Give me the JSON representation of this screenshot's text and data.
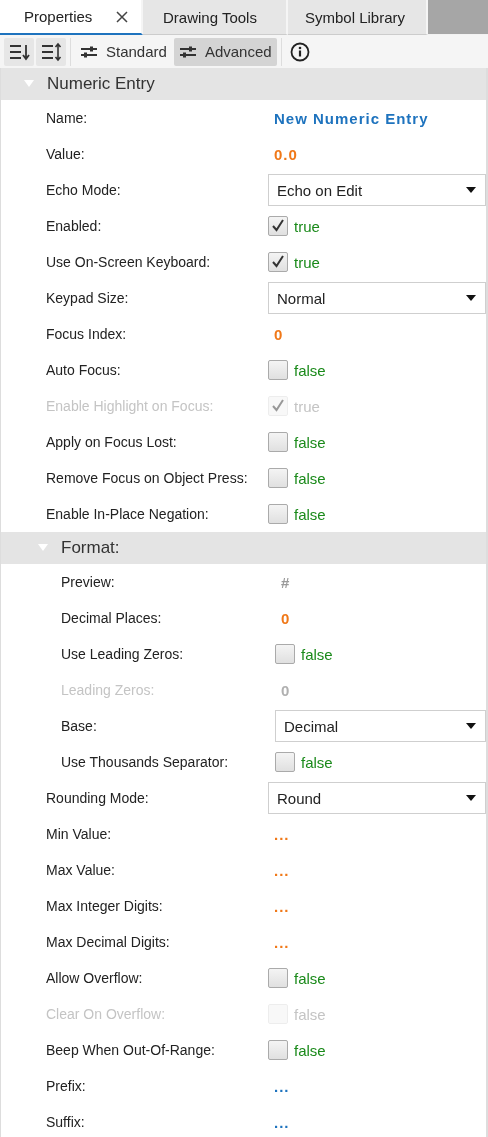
{
  "tabs": [
    {
      "label": "Properties",
      "selected": true,
      "closable": true
    },
    {
      "label": "Drawing Tools",
      "selected": false,
      "closable": false
    },
    {
      "label": "Symbol Library",
      "selected": false,
      "closable": false
    }
  ],
  "toolbar": {
    "views": [
      {
        "label": "Standard",
        "selected": false
      },
      {
        "label": "Advanced",
        "selected": true
      }
    ]
  },
  "section": {
    "title": "Numeric Entry",
    "expanded": true,
    "rows": [
      {
        "kind": "text",
        "label": "Name:",
        "value": "New Numeric Entry",
        "color": "#1e73be",
        "disabled": false
      },
      {
        "kind": "text",
        "label": "Value:",
        "value": "0.0",
        "color": "#f07818",
        "disabled": false
      },
      {
        "kind": "dropdown",
        "label": "Echo Mode:",
        "value": "Echo on Edit",
        "disabled": false
      },
      {
        "kind": "checkbox",
        "label": "Enabled:",
        "checked": true,
        "value": "true",
        "disabled": false
      },
      {
        "kind": "checkbox",
        "label": "Use On-Screen Keyboard:",
        "checked": true,
        "value": "true",
        "disabled": false
      },
      {
        "kind": "dropdown",
        "label": "Keypad Size:",
        "value": "Normal",
        "disabled": false
      },
      {
        "kind": "text",
        "label": "Focus Index:",
        "value": "0",
        "color": "#f07818",
        "disabled": false
      },
      {
        "kind": "checkbox",
        "label": "Auto Focus:",
        "checked": false,
        "value": "false",
        "disabled": false
      },
      {
        "kind": "checkbox",
        "label": "Enable Highlight on Focus:",
        "checked": true,
        "value": "true",
        "disabled": true
      },
      {
        "kind": "checkbox",
        "label": "Apply on Focus Lost:",
        "checked": false,
        "value": "false",
        "disabled": false
      },
      {
        "kind": "checkbox",
        "label": "Remove Focus on Object Press:",
        "checked": false,
        "value": "false",
        "disabled": false
      },
      {
        "kind": "checkbox",
        "label": "Enable In-Place Negation:",
        "checked": false,
        "value": "false",
        "disabled": false
      },
      {
        "kind": "group",
        "label": "Format:",
        "expanded": true,
        "children": [
          {
            "kind": "text",
            "label": "Preview:",
            "value": "#",
            "color": "#9a9a9a",
            "disabled": false
          },
          {
            "kind": "text",
            "label": "Decimal Places:",
            "value": "0",
            "color": "#f07818",
            "disabled": false
          },
          {
            "kind": "checkbox",
            "label": "Use Leading Zeros:",
            "checked": false,
            "value": "false",
            "disabled": false
          },
          {
            "kind": "text",
            "label": "Leading Zeros:",
            "value": "0",
            "color": "#b0b0b0",
            "disabled": true
          },
          {
            "kind": "dropdown",
            "label": "Base:",
            "value": "Decimal",
            "disabled": false
          },
          {
            "kind": "checkbox",
            "label": "Use Thousands Separator:",
            "checked": false,
            "value": "false",
            "disabled": false
          }
        ]
      },
      {
        "kind": "dropdown",
        "label": "Rounding Mode:",
        "value": "Round",
        "disabled": false
      },
      {
        "kind": "text",
        "label": "Min Value:",
        "value": "...",
        "color": "#f07818",
        "disabled": false
      },
      {
        "kind": "text",
        "label": "Max Value:",
        "value": "...",
        "color": "#f07818",
        "disabled": false
      },
      {
        "kind": "text",
        "label": "Max Integer Digits:",
        "value": "...",
        "color": "#f07818",
        "disabled": false
      },
      {
        "kind": "text",
        "label": "Max Decimal Digits:",
        "value": "...",
        "color": "#f07818",
        "disabled": false
      },
      {
        "kind": "checkbox",
        "label": "Allow Overflow:",
        "checked": false,
        "value": "false",
        "disabled": false
      },
      {
        "kind": "checkbox",
        "label": "Clear On Overflow:",
        "checked": false,
        "value": "false",
        "disabled": true
      },
      {
        "kind": "checkbox",
        "label": "Beep When Out-Of-Range:",
        "checked": false,
        "value": "false",
        "disabled": false
      },
      {
        "kind": "text",
        "label": "Prefix:",
        "value": "...",
        "color": "#1e73be",
        "disabled": false
      },
      {
        "kind": "text",
        "label": "Suffix:",
        "value": "...",
        "color": "#1e73be",
        "disabled": false
      }
    ]
  }
}
